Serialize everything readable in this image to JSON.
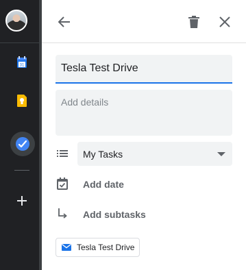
{
  "rail": {
    "icons": [
      "avatar",
      "calendar-icon",
      "keep-icon",
      "tasks-icon",
      "add-icon"
    ],
    "calendar_day": "31"
  },
  "header": {
    "back_icon": "arrow-left-icon",
    "delete_icon": "trash-icon",
    "close_icon": "close-icon"
  },
  "task": {
    "title": "Tesla Test Drive",
    "details_placeholder": "Add details",
    "list_name": "My Tasks",
    "add_date_label": "Add date",
    "add_subtasks_label": "Add subtasks",
    "linked_email_subject": "Tesla Test Drive"
  },
  "colors": {
    "accent": "#1a73e8",
    "rail_bg": "#202124",
    "field_bg": "#f1f3f4"
  }
}
